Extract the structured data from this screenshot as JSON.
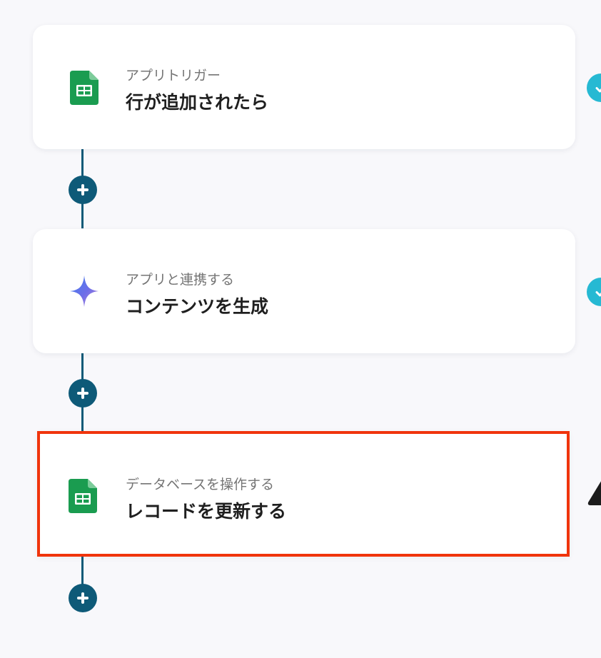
{
  "colors": {
    "background": "#f8f8fb",
    "connector": "#0e5a78",
    "card": "#ffffff",
    "selected_border": "#f0340c",
    "status_ok": "#26b9d3",
    "status_warning": "#1c1c1c"
  },
  "steps": [
    {
      "label": "アプリトリガー",
      "title": "行が追加されたら",
      "icon": "google-sheets-icon",
      "status": "completed"
    },
    {
      "label": "アプリと連携する",
      "title": "コンテンツを生成",
      "icon": "gemini-icon",
      "status": "completed"
    },
    {
      "label": "データベースを操作する",
      "title": "レコードを更新する",
      "icon": "google-sheets-icon",
      "status": "warning",
      "selected": true
    }
  ],
  "add_step_buttons": [
    {
      "icon": "plus-icon"
    },
    {
      "icon": "plus-icon"
    },
    {
      "icon": "plus-icon"
    }
  ]
}
